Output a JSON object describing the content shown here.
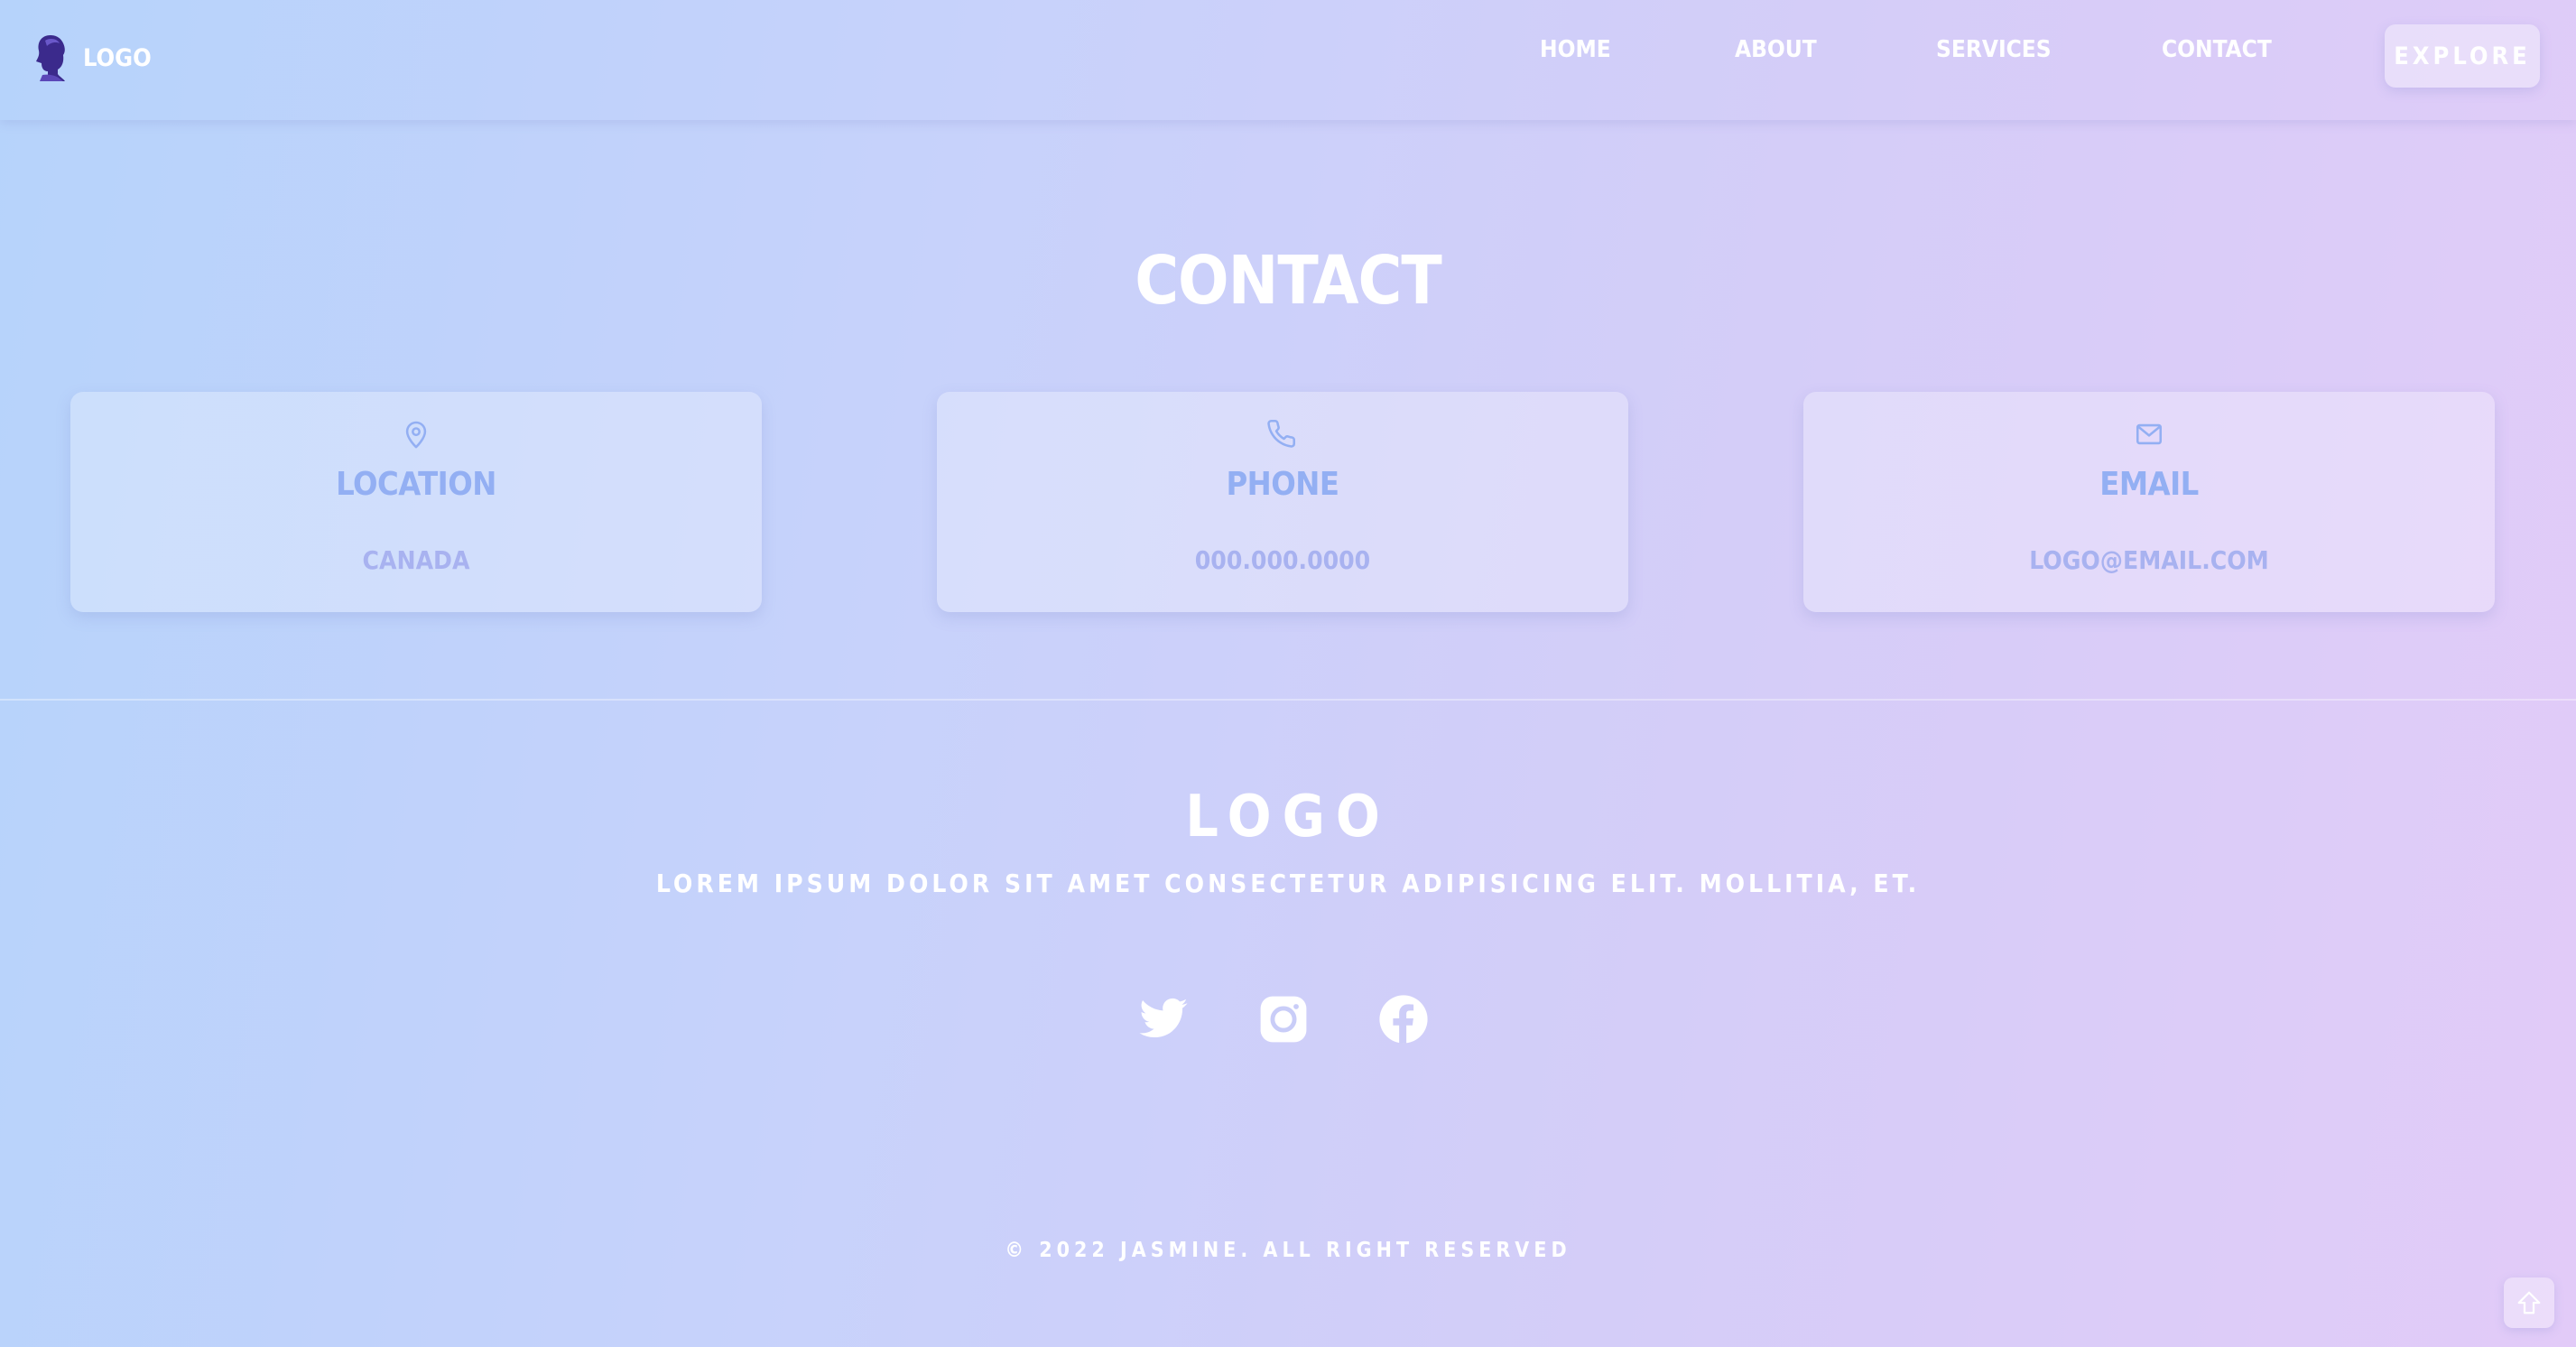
{
  "header": {
    "logo_text": "LOGO",
    "nav": [
      "HOME",
      "ABOUT",
      "SERVICES",
      "CONTACT"
    ],
    "explore_label": "EXPLORE"
  },
  "contact": {
    "title": "CONTACT",
    "cards": [
      {
        "icon": "map-pin-icon",
        "title": "LOCATION",
        "value": "CANADA"
      },
      {
        "icon": "phone-icon",
        "title": "PHONE",
        "value": "000.000.0000"
      },
      {
        "icon": "mail-icon",
        "title": "EMAIL",
        "value": "LOGO@EMAIL.COM"
      }
    ]
  },
  "footer": {
    "logo": "LOGO",
    "tagline": "LOREM IPSUM DOLOR SIT AMET CONSECTETUR ADIPISICING ELIT. MOLLITIA, ET.",
    "social": [
      "twitter-icon",
      "instagram-icon",
      "facebook-icon"
    ],
    "copyright": "© 2022 JASMINE. ALL RIGHT RESERVED"
  },
  "colors": {
    "card_title": "#93aff3",
    "card_value": "#a8b2f0",
    "brand_mark": "#3b2a8c"
  }
}
